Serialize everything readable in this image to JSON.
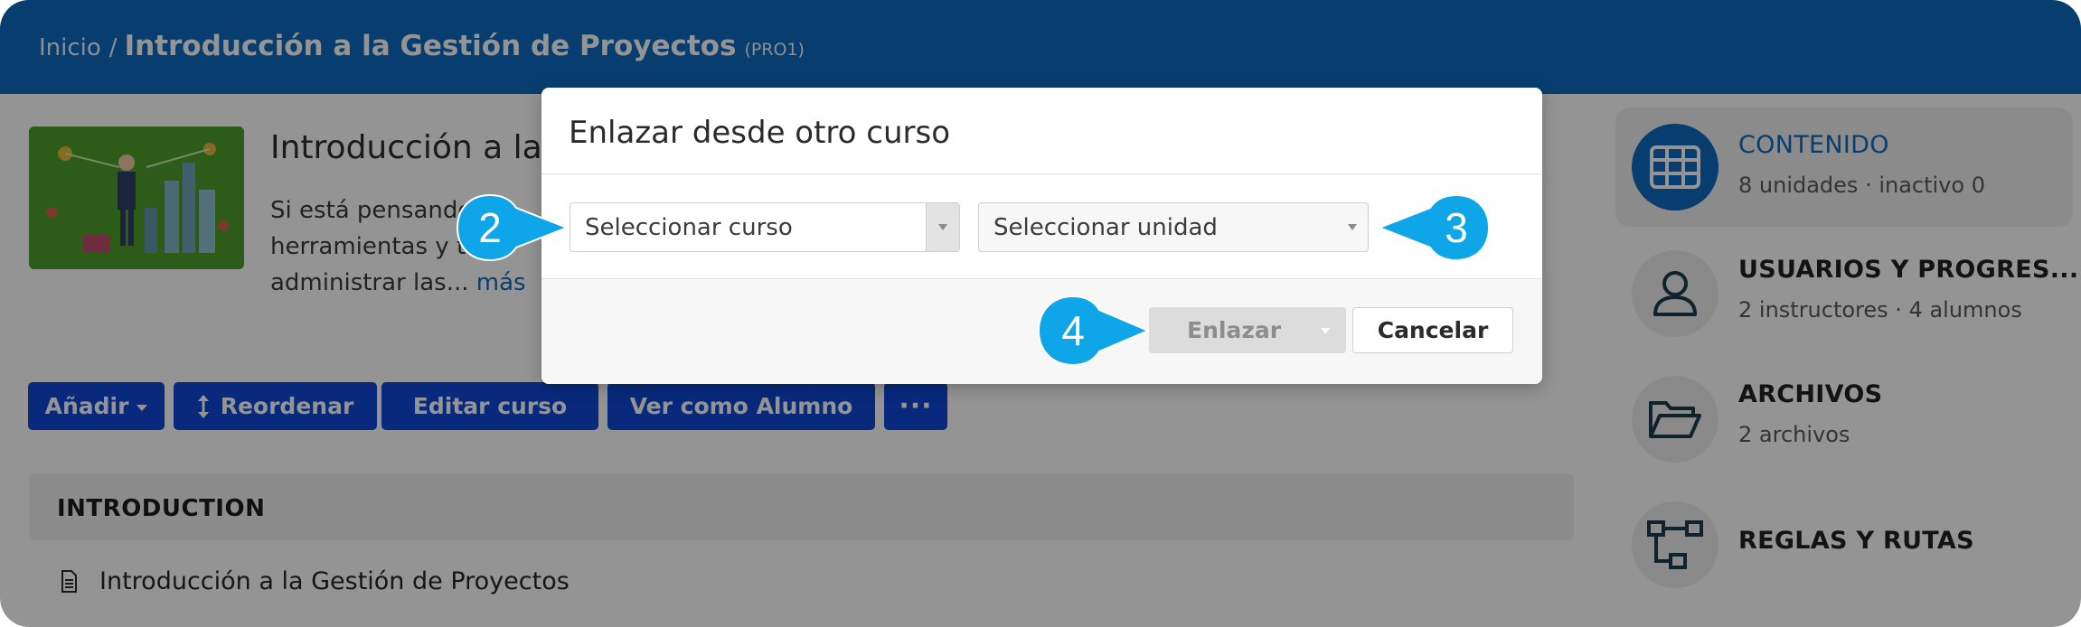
{
  "breadcrumb": {
    "home": "Inicio",
    "separator": "/",
    "course": "Introducción a la Gestión de Proyectos",
    "code": "(PRO1)"
  },
  "course": {
    "title": "Introducción a la",
    "description_lines": [
      "Si está pensando",
      "herramientas y téc",
      "administrar las..."
    ],
    "more_link": "más"
  },
  "toolbar": {
    "add_label": "Añadir",
    "reorder_label": "Reordenar",
    "edit_label": "Editar curso",
    "view_as_student_label": "Ver como Alumno",
    "more_label": "···"
  },
  "section": {
    "title": "INTRODUCTION",
    "activity": "Introducción a la Gestión de Proyectos"
  },
  "side_panel": [
    {
      "title": "CONTENIDO",
      "subtitle": "8 unidades · inactivo 0",
      "icon": "grid-icon",
      "active": true
    },
    {
      "title": "USUARIOS Y PROGRES...",
      "subtitle": "2 instructores · 4 alumnos",
      "icon": "user-icon",
      "active": false
    },
    {
      "title": "ARCHIVOS",
      "subtitle": "2 archivos",
      "icon": "folder-open-icon",
      "active": false
    },
    {
      "title": "REGLAS Y RUTAS",
      "subtitle": "",
      "icon": "flow-rules-icon",
      "active": false
    }
  ],
  "modal": {
    "title": "Enlazar desde otro curso",
    "course_select_placeholder": "Seleccionar curso",
    "unit_select_placeholder": "Seleccionar unidad",
    "link_label": "Enlazar",
    "cancel_label": "Cancelar"
  },
  "callouts": [
    "2",
    "3",
    "4"
  ],
  "colors": {
    "header": "#0f6cbf",
    "primary_button": "#0f47d6",
    "callout": "#0ea5e9",
    "overlay": "rgba(0,0,0,0.42)"
  }
}
